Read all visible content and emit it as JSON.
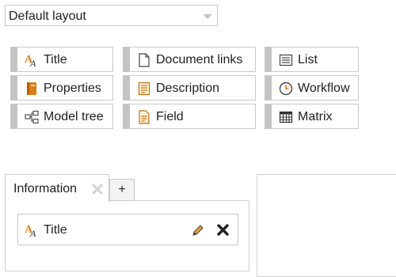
{
  "layout_select": {
    "value": "Default layout",
    "caret_icon": "chevron-down-icon"
  },
  "widgets": [
    {
      "label": "Title",
      "icon": "title-icon"
    },
    {
      "label": "Document links",
      "icon": "document-icon"
    },
    {
      "label": "List",
      "icon": "list-icon"
    },
    {
      "label": "Properties",
      "icon": "properties-book-icon"
    },
    {
      "label": "Description",
      "icon": "description-icon"
    },
    {
      "label": "Workflow",
      "icon": "clock-icon"
    },
    {
      "label": "Model tree",
      "icon": "model-tree-icon"
    },
    {
      "label": "Field",
      "icon": "field-icon"
    },
    {
      "label": "Matrix",
      "icon": "matrix-icon"
    }
  ],
  "tabs": {
    "active": {
      "label": "Information",
      "close_icon": "close-icon"
    },
    "add_label": "+"
  },
  "panel_widget": {
    "label": "Title",
    "icon": "title-icon",
    "edit_icon": "pencil-icon",
    "remove_icon": "close-icon"
  },
  "colors": {
    "accent_orange": "#e07b10",
    "grip": "#c3c3c3",
    "border": "#c8c8c8"
  }
}
